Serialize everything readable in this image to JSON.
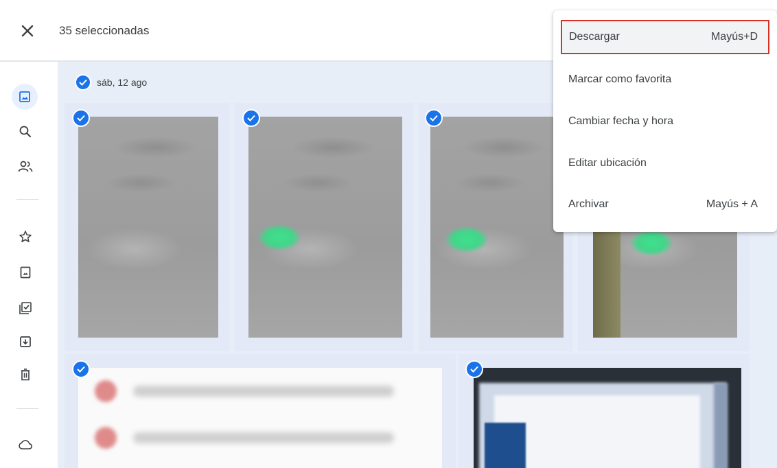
{
  "topbar": {
    "selected_count": "35 seleccionadas",
    "close_icon": "close-icon"
  },
  "rail": {
    "items": [
      {
        "icon": "photos-icon",
        "active": true
      },
      {
        "icon": "search-icon"
      },
      {
        "icon": "people-icon"
      },
      {
        "icon": "star-icon"
      },
      {
        "icon": "albums-icon"
      },
      {
        "icon": "utilities-icon"
      },
      {
        "icon": "archive-icon"
      },
      {
        "icon": "trash-icon"
      },
      {
        "icon": "cloud-icon"
      }
    ]
  },
  "group": {
    "date_label": "sáb, 12 ago"
  },
  "menu": {
    "items": [
      {
        "label": "Descargar",
        "shortcut": "Mayús+D",
        "highlighted": true
      },
      {
        "label": "Marcar como favorita",
        "shortcut": ""
      },
      {
        "label": "Cambiar fecha y hora",
        "shortcut": ""
      },
      {
        "label": "Editar ubicación",
        "shortcut": ""
      },
      {
        "label": "Archivar",
        "shortcut": "Mayús + A"
      }
    ]
  },
  "colors": {
    "accent": "#1a73e8",
    "highlight_border": "#d93025",
    "content_bg": "#e8eef8"
  }
}
